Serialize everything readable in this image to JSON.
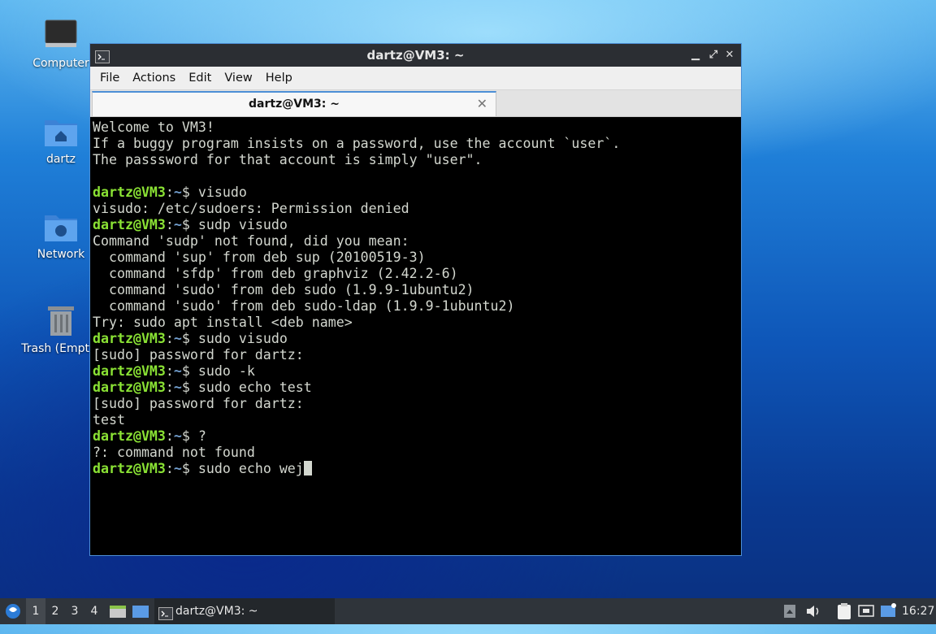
{
  "desktop": {
    "icons": [
      {
        "label": "Computer",
        "icon": "computer-icon"
      },
      {
        "label": "dartz",
        "icon": "home-folder-icon"
      },
      {
        "label": "Network",
        "icon": "network-folder-icon"
      },
      {
        "label": "Trash (Empty)",
        "icon": "trash-icon"
      }
    ]
  },
  "window": {
    "title": "dartz@VM3: ~",
    "controls": {
      "minimize": "▁",
      "maximize": "⤢",
      "close": "✕"
    },
    "menu": [
      "File",
      "Actions",
      "Edit",
      "View",
      "Help"
    ],
    "tab": {
      "label": "dartz@VM3: ~",
      "close": "✕"
    }
  },
  "terminal": {
    "lines": [
      {
        "text": "Welcome to VM3!"
      },
      {
        "text": "If a buggy program insists on a password, use the account `user`."
      },
      {
        "text": "The passsword for that account is simply \"user\"."
      },
      {
        "text": ""
      },
      {
        "user": "dartz@VM3",
        "path": "~",
        "cmd": " visudo"
      },
      {
        "text": "visudo: /etc/sudoers: Permission denied"
      },
      {
        "user": "dartz@VM3",
        "path": "~",
        "cmd": " sudp visudo"
      },
      {
        "text": "Command 'sudp' not found, did you mean:"
      },
      {
        "text": "  command 'sup' from deb sup (20100519-3)"
      },
      {
        "text": "  command 'sfdp' from deb graphviz (2.42.2-6)"
      },
      {
        "text": "  command 'sudo' from deb sudo (1.9.9-1ubuntu2)"
      },
      {
        "text": "  command 'sudo' from deb sudo-ldap (1.9.9-1ubuntu2)"
      },
      {
        "text": "Try: sudo apt install <deb name>"
      },
      {
        "user": "dartz@VM3",
        "path": "~",
        "cmd": " sudo visudo"
      },
      {
        "text": "[sudo] password for dartz:"
      },
      {
        "user": "dartz@VM3",
        "path": "~",
        "cmd": " sudo -k"
      },
      {
        "user": "dartz@VM3",
        "path": "~",
        "cmd": " sudo echo test"
      },
      {
        "text": "[sudo] password for dartz:"
      },
      {
        "text": "test"
      },
      {
        "user": "dartz@VM3",
        "path": "~",
        "cmd": " ?"
      },
      {
        "text": "?: command not found"
      },
      {
        "user": "dartz@VM3",
        "path": "~",
        "cmd": " sudo echo wej",
        "cursor": true
      }
    ]
  },
  "taskbar": {
    "workspaces": [
      "1",
      "2",
      "3",
      "4"
    ],
    "active_workspace": "1",
    "task_label": "dartz@VM3: ~",
    "clock": "16:27"
  }
}
